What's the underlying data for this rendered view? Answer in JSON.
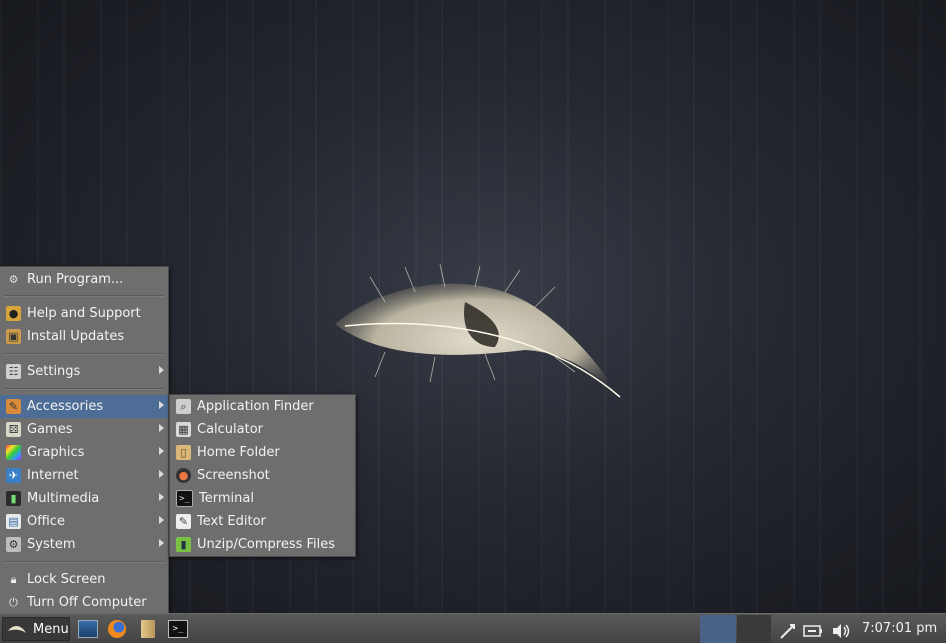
{
  "main_menu": {
    "items": [
      {
        "label": "Run Program...",
        "icon": "gear-icon"
      },
      {
        "label": "Help and Support",
        "icon": "help-icon"
      },
      {
        "label": "Install Updates",
        "icon": "package-icon"
      },
      {
        "label": "Settings",
        "icon": "settings-icon",
        "submenu": true
      },
      {
        "label": "Accessories",
        "icon": "accessories-icon",
        "submenu": true,
        "active": true
      },
      {
        "label": "Games",
        "icon": "games-icon",
        "submenu": true
      },
      {
        "label": "Graphics",
        "icon": "graphics-icon",
        "submenu": true
      },
      {
        "label": "Internet",
        "icon": "internet-icon",
        "submenu": true
      },
      {
        "label": "Multimedia",
        "icon": "multimedia-icon",
        "submenu": true
      },
      {
        "label": "Office",
        "icon": "office-icon",
        "submenu": true
      },
      {
        "label": "System",
        "icon": "system-icon",
        "submenu": true
      },
      {
        "label": "Lock Screen",
        "icon": "lock-icon"
      },
      {
        "label": "Turn Off Computer",
        "icon": "power-icon"
      }
    ]
  },
  "accessories_menu": {
    "items": [
      {
        "label": "Application Finder",
        "icon": "search-icon"
      },
      {
        "label": "Calculator",
        "icon": "calculator-icon"
      },
      {
        "label": "Home Folder",
        "icon": "folder-icon"
      },
      {
        "label": "Screenshot",
        "icon": "camera-icon"
      },
      {
        "label": "Terminal",
        "icon": "terminal-icon"
      },
      {
        "label": "Text Editor",
        "icon": "text-editor-icon"
      },
      {
        "label": "Unzip/Compress Files",
        "icon": "archive-icon"
      }
    ]
  },
  "taskbar": {
    "menu_label": "Menu",
    "launchers": [
      "desktop-icon",
      "firefox-icon",
      "file-manager-icon",
      "terminal-icon"
    ],
    "tray": [
      "network-icon",
      "battery-icon",
      "volume-icon"
    ],
    "clock": "7:07:01 pm"
  }
}
